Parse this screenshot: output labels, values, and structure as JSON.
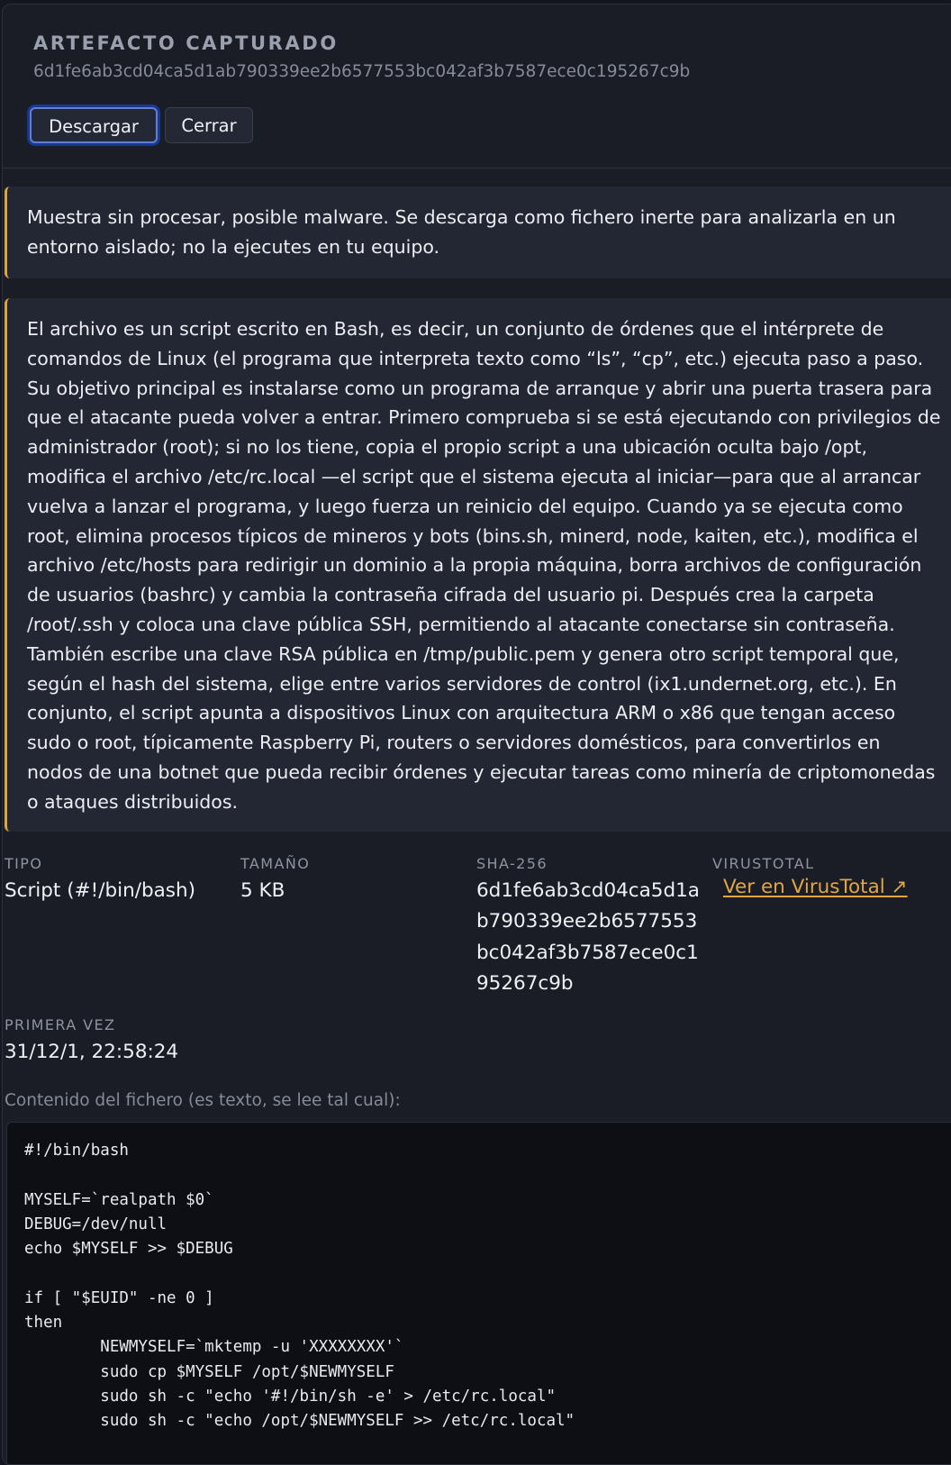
{
  "header": {
    "eyebrow": "ARTEFACTO CAPTURADO",
    "hash": "6d1fe6ab3cd04ca5d1ab790339ee2b6577553bc042af3b7587ece0c195267c9b",
    "download_label": "Descargar",
    "close_label": "Cerrar"
  },
  "warning": {
    "text": "Muestra sin procesar, posible malware. Se descarga como fichero inerte para analizarla en un entorno aislado; no la ejecutes en tu equipo."
  },
  "summary": {
    "text": "El archivo es un script escrito en Bash, es decir, un conjunto de órdenes que el intérprete de comandos de Linux (el programa que interpreta texto como “ls”, “cp”, etc.) ejecuta paso a paso. Su objetivo principal es instalarse como un programa de arranque y abrir una puerta trasera para que el atacante pueda volver a entrar. Primero comprueba si se está ejecutando con privilegios de administrador (root); si no los tiene, copia el propio script a una ubicación oculta bajo /opt, modifica el archivo /etc/rc.local —el script que el sistema ejecuta al iniciar—para que al arrancar vuelva a lanzar el programa, y luego fuerza un reinicio del equipo. Cuando ya se ejecuta como root, elimina procesos típicos de mineros y bots (bins.sh, minerd, node, kaiten, etc.), modifica el archivo /etc/hosts para redirigir un dominio a la propia máquina, borra archivos de configuración de usuarios (bashrc) y cambia la contraseña cifrada del usuario pi. Después crea la carpeta /root/.ssh y coloca una clave pública SSH, permitiendo al atacante conectarse sin contraseña. También escribe una clave RSA pública en /tmp/public.pem y genera otro script temporal que, según el hash del sistema, elige entre varios servidores de control (ix1.undernet.org, etc.). En conjunto, el script apunta a dispositivos Linux con arquitectura ARM o x86 que tengan acceso sudo o root, típicamente Raspberry Pi, routers o servidores domésticos, para convertirlos en nodos de una botnet que pueda recibir órdenes y ejecutar tareas como minería de criptomonedas o ataques distribuidos."
  },
  "meta": {
    "type_label": "TIPO",
    "type_value": "Script (#!/bin/bash)",
    "size_label": "TAMAÑO",
    "size_value": "5 KB",
    "sha_label": "SHA-256",
    "sha_lines": [
      "6d1fe6ab3cd04ca5d1a",
      "b790339ee2b6577553",
      "bc042af3b7587ece0c1",
      "95267c9b"
    ],
    "vt_label": "VIRUSTOTAL",
    "vt_link": "Ver en VirusTotal ↗",
    "first_seen_label": "PRIMERA VEZ",
    "first_seen_value": "31/12/1, 22:58:24"
  },
  "content": {
    "label": "Contenido del fichero (es texto, se lee tal cual):",
    "code": "#!/bin/bash\n\nMYSELF=`realpath $0`\nDEBUG=/dev/null\necho $MYSELF >> $DEBUG\n\nif [ \"$EUID\" -ne 0 ]\nthen\n        NEWMYSELF=`mktemp -u 'XXXXXXXX'`\n        sudo cp $MYSELF /opt/$NEWMYSELF\n        sudo sh -c \"echo '#!/bin/sh -e' > /etc/rc.local\"\n        sudo sh -c \"echo /opt/$NEWMYSELF >> /etc/rc.local\""
  },
  "colors": {
    "background": "#1a1d26",
    "accent": "#d9a53d",
    "link": "#e0a646",
    "focus_ring": "#19388f"
  }
}
